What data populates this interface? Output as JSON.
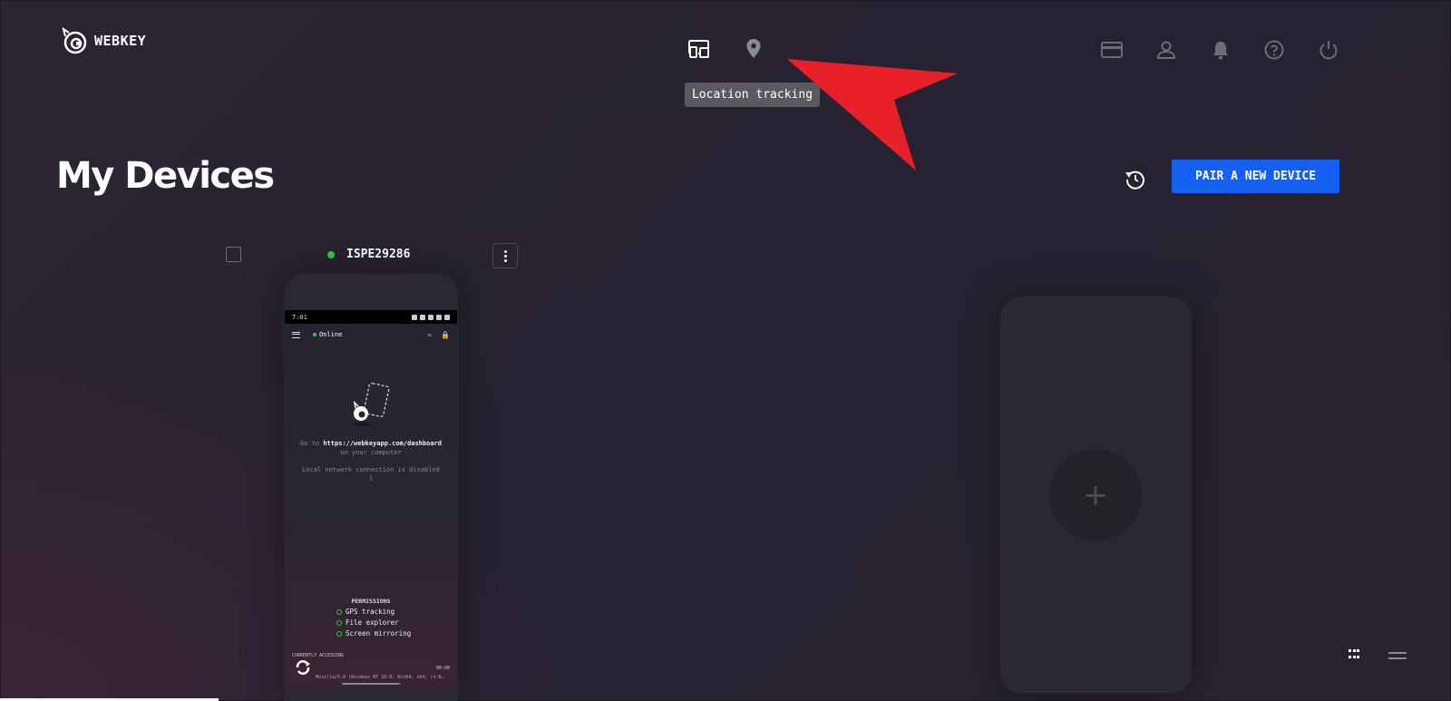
{
  "app": {
    "logo_text": "WEBKEY"
  },
  "topnav": {
    "center_icons": [
      "devices-icon",
      "location-pin-icon"
    ],
    "right_icons": [
      "credit-card-icon",
      "user-icon",
      "bell-icon",
      "help-icon",
      "power-icon"
    ],
    "tooltip": "Location tracking"
  },
  "page": {
    "title": "My Devices",
    "pair_button": "PAIR A NEW DEVICE"
  },
  "device": {
    "name": "ISPE29286",
    "status_color": "#27d13c",
    "screen": {
      "time": "7:01",
      "status": "Online",
      "go_to_prefix": "Go to",
      "url": "https://webkeyapp.com/dashboard",
      "go_to_suffix": "on your computer",
      "local_network": "Local network connection is disabled",
      "permissions_title": "PERMISSIONS",
      "permissions": [
        "GPS tracking",
        "File explorer",
        "Screen mirroring"
      ],
      "currently_accessing": "CURRENTLY ACCESSING",
      "access_time": "00:00",
      "user_agent": "Mozilla/5.0 (Windows NT 10.0; Win64; x64; rv:8…"
    }
  },
  "add_device": {
    "symbol": "+"
  },
  "colors": {
    "accent": "#1560f0",
    "annotation_arrow": "#e8202a"
  }
}
